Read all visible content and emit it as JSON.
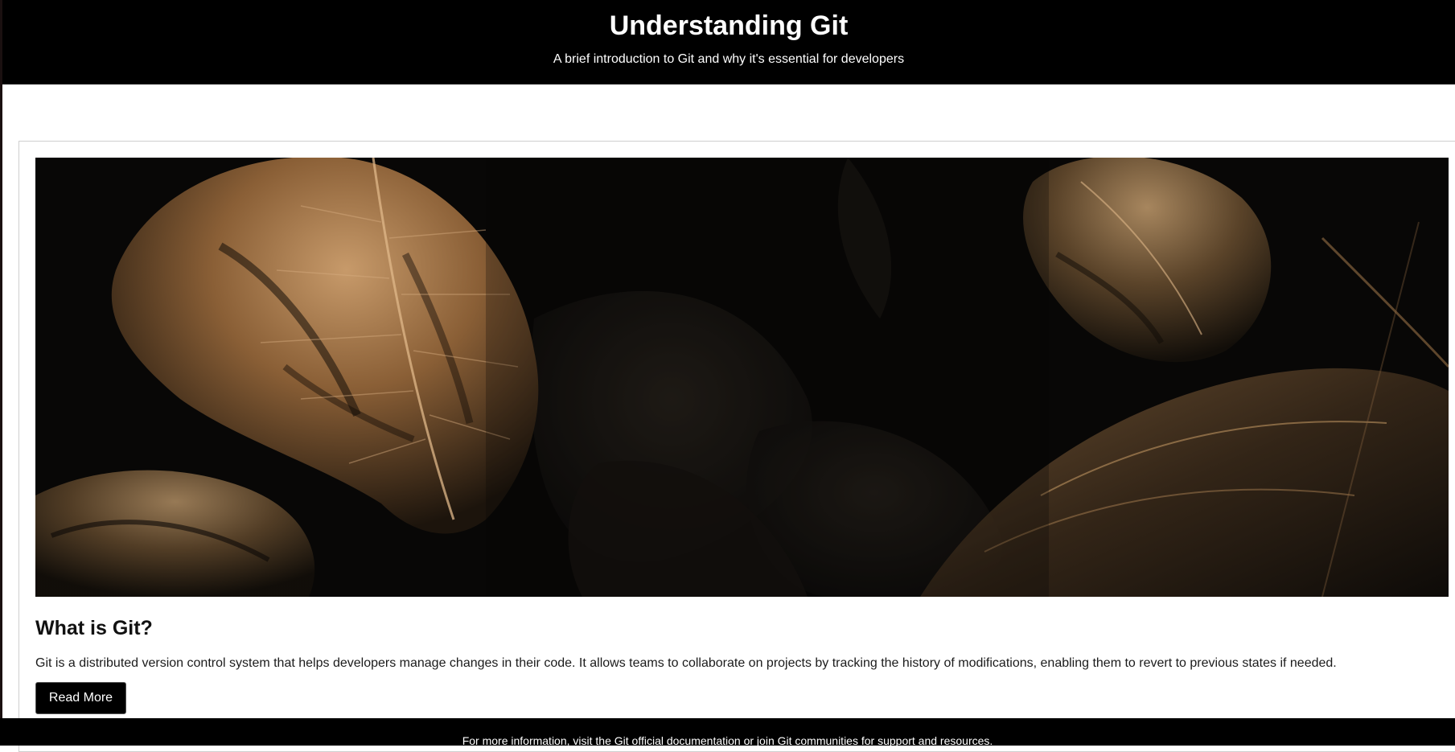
{
  "header": {
    "title": "Understanding Git",
    "subtitle": "A brief introduction to Git and why it's essential for developers"
  },
  "article": {
    "image_alt": "dark leaves with golden light",
    "title": "What is Git?",
    "body": "Git is a distributed version control system that helps developers manage changes in their code. It allows teams to collaborate on projects by tracking the history of modifications, enabling them to revert to previous states if needed.",
    "button_label": "Read More"
  },
  "footer": {
    "text": "For more information, visit the Git official documentation or join Git communities for support and resources."
  },
  "colors": {
    "header_bg": "#000000",
    "footer_bg": "#000000",
    "button_bg": "#000000",
    "leaf_gold": "#b08050"
  }
}
